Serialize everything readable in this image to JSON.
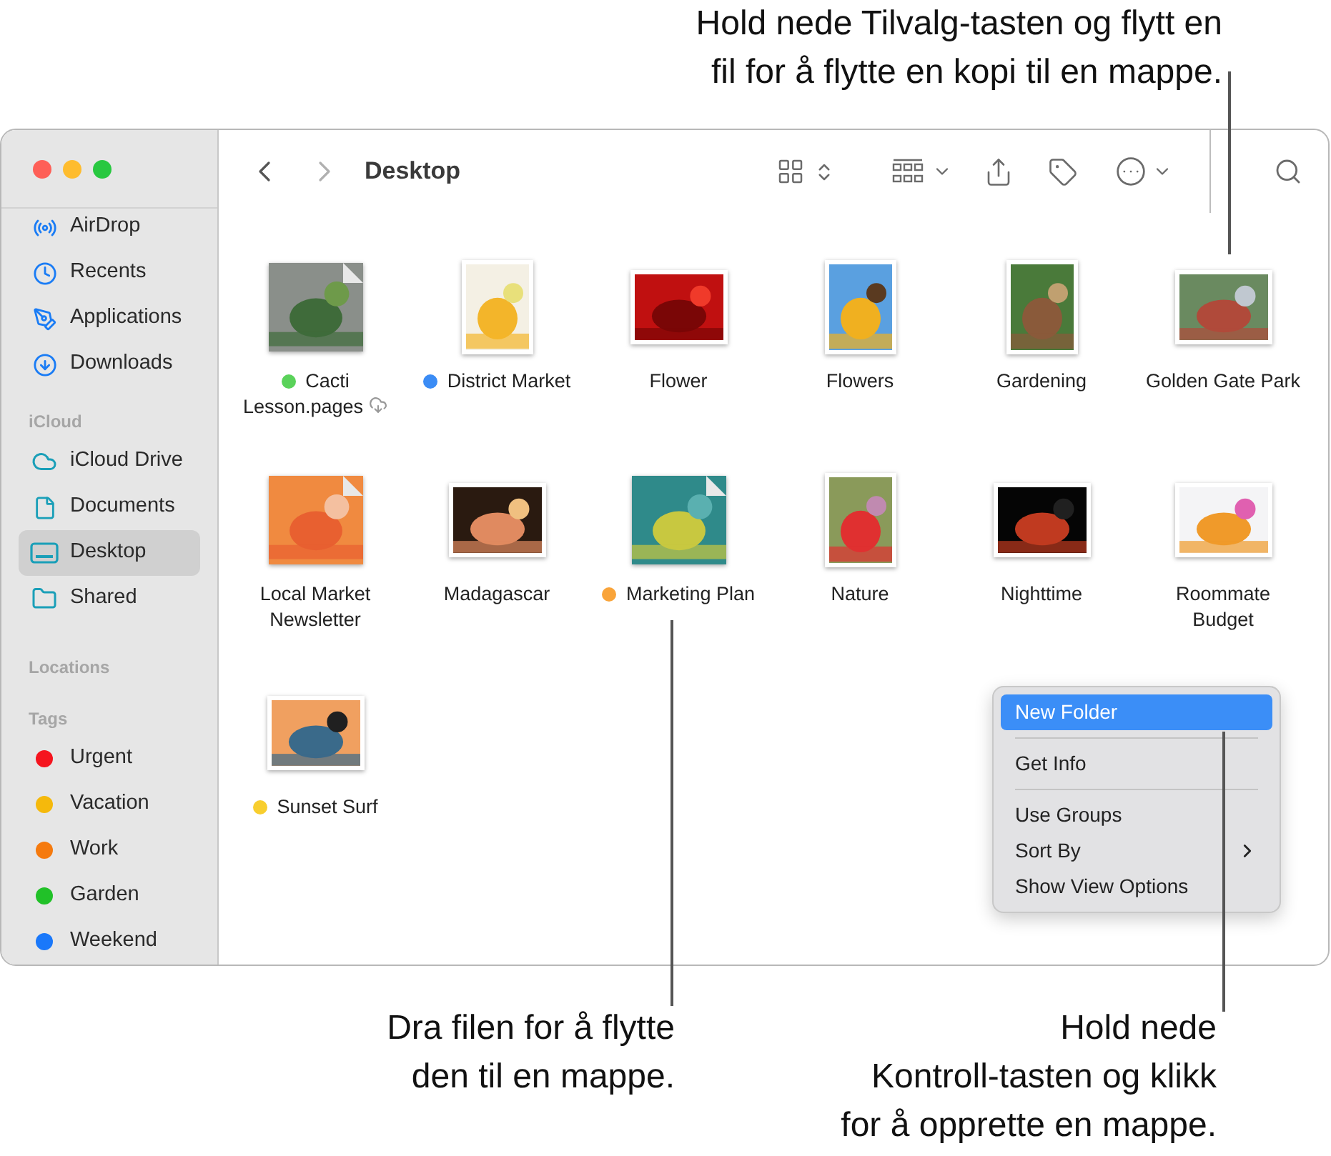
{
  "callouts": {
    "top": {
      "lines": [
        "Hold nede Tilvalg-tasten og flytt en",
        "fil for å flytte en kopi til en mappe."
      ]
    },
    "bottom_left": {
      "lines": [
        "Dra filen for å flytte",
        "den til en mappe."
      ]
    },
    "bottom_right": {
      "lines": [
        "Hold nede",
        "Kontroll-tasten og klikk",
        "for å opprette en mappe."
      ]
    }
  },
  "sidebar": {
    "favorites": [
      {
        "label": "AirDrop",
        "selected": false
      },
      {
        "label": "Recents",
        "selected": false
      },
      {
        "label": "Applications",
        "selected": false
      },
      {
        "label": "Downloads",
        "selected": false
      }
    ],
    "icloud": {
      "heading": "iCloud",
      "items": [
        {
          "label": "iCloud Drive",
          "selected": false
        },
        {
          "label": "Documents",
          "selected": false
        },
        {
          "label": "Desktop",
          "selected": true
        },
        {
          "label": "Shared",
          "selected": false
        }
      ]
    },
    "locations": {
      "heading": "Locations"
    },
    "tags": {
      "heading": "Tags",
      "items": [
        {
          "label": "Urgent",
          "color": "#f5141e"
        },
        {
          "label": "Vacation",
          "color": "#f5b90c"
        },
        {
          "label": "Work",
          "color": "#f57a0e"
        },
        {
          "label": "Garden",
          "color": "#21c128"
        },
        {
          "label": "Weekend",
          "color": "#1a78fa"
        }
      ]
    }
  },
  "toolbar": {
    "title": "Desktop"
  },
  "files": [
    {
      "name": "Cacti Lesson.pages",
      "kind": "document",
      "color": "#5ad25a",
      "in_cloud": true
    },
    {
      "name": "District Market",
      "kind": "portrait",
      "color": "#3b8cf5",
      "in_cloud": false
    },
    {
      "name": "Flower",
      "kind": "landscape",
      "in_cloud": false
    },
    {
      "name": "Flowers",
      "kind": "portrait",
      "in_cloud": false
    },
    {
      "name": "Gardening",
      "kind": "portrait",
      "in_cloud": false
    },
    {
      "name": "Golden Gate Park",
      "kind": "landscape",
      "in_cloud": false
    },
    {
      "name": "Local Market Newsletter",
      "kind": "document",
      "in_cloud": false
    },
    {
      "name": "Madagascar",
      "kind": "landscape",
      "in_cloud": false
    },
    {
      "name": "Marketing Plan",
      "kind": "document",
      "color": "#f9a43a",
      "in_cloud": false
    },
    {
      "name": "Nature",
      "kind": "portrait",
      "in_cloud": false
    },
    {
      "name": "Nighttime",
      "kind": "landscape",
      "in_cloud": false
    },
    {
      "name": "Roommate Budget",
      "kind": "landscape",
      "in_cloud": false
    },
    {
      "name": "Sunset Surf",
      "kind": "landscape",
      "color": "#f8ce2e",
      "in_cloud": false
    }
  ],
  "context_menu": {
    "groups": [
      [
        {
          "label": "New Folder",
          "selected": true,
          "submenu": false
        }
      ],
      [
        {
          "label": "Get Info",
          "selected": false,
          "submenu": false
        }
      ],
      [
        {
          "label": "Use Groups",
          "selected": false,
          "submenu": false
        },
        {
          "label": "Sort By",
          "selected": false,
          "submenu": true
        },
        {
          "label": "Show View Options",
          "selected": false,
          "submenu": false
        }
      ]
    ]
  }
}
